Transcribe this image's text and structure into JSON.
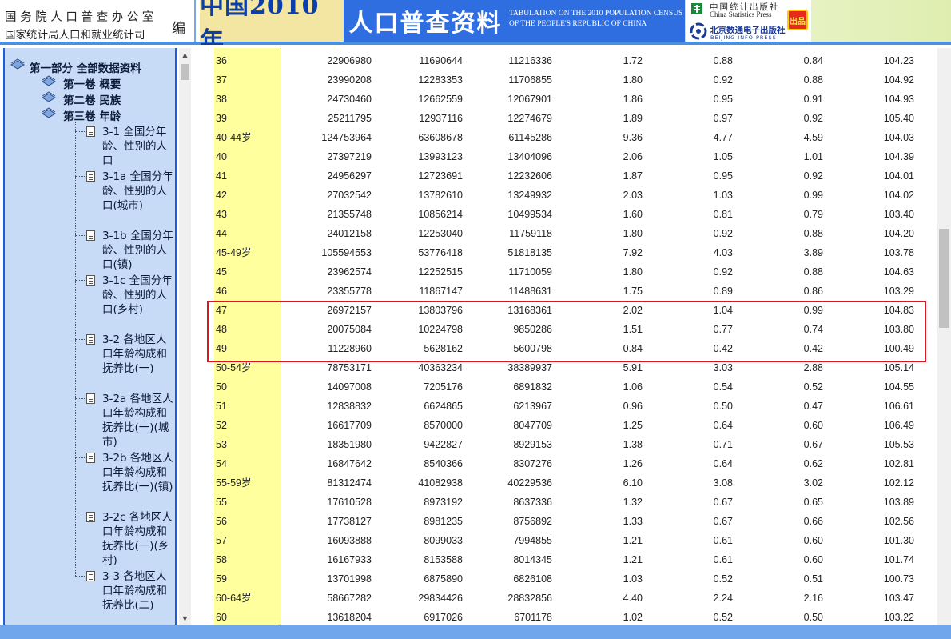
{
  "header": {
    "office": "国务院人口普查办公室",
    "bureau": "国家统计局人口和就业统计司",
    "bian": "编",
    "title_main": "中国2010年",
    "title_sub": "人口普查资料",
    "subtitle_en": "TABULATION ON THE 2010 POPULATION CENSUS OF THE PEOPLE'S REPUBLIC OF CHINA",
    "publisher1_cn": "中国统计出版社",
    "publisher1_en": "China Statistics Press",
    "publisher2_cn": "北京数通电子出版社",
    "publisher2_en": "BEIJING INFO PRESS",
    "badge": "出品"
  },
  "sidebar": {
    "part": "第一部分  全部数据资料",
    "volumes": [
      "第一卷  概要",
      "第二卷  民族",
      "第三卷  年龄"
    ],
    "items": [
      "3-1 全国分年龄、性别的人口",
      "3-1a 全国分年龄、性别的人口(城市)",
      "3-1b 全国分年龄、性别的人口(镇)",
      "3-1c 全国分年龄、性别的人口(乡村)",
      "3-2 各地区人口年龄构成和抚养比(一)",
      "3-2a 各地区人口年龄构成和抚养比(一)(城市)",
      "3-2b 各地区人口年龄构成和抚养比(一)(镇)",
      "3-2c 各地区人口年龄构成和抚养比(一)(乡村)",
      "3-3 各地区人口年龄构成和抚养比(二)"
    ]
  },
  "table": {
    "rows": [
      [
        "36",
        "22906980",
        "11690644",
        "11216336",
        "1.72",
        "0.88",
        "0.84",
        "104.23"
      ],
      [
        "37",
        "23990208",
        "12283353",
        "11706855",
        "1.80",
        "0.92",
        "0.88",
        "104.92"
      ],
      [
        "38",
        "24730460",
        "12662559",
        "12067901",
        "1.86",
        "0.95",
        "0.91",
        "104.93"
      ],
      [
        "39",
        "25211795",
        "12937116",
        "12274679",
        "1.89",
        "0.97",
        "0.92",
        "105.40"
      ],
      [
        "40-44岁",
        "124753964",
        "63608678",
        "61145286",
        "9.36",
        "4.77",
        "4.59",
        "104.03"
      ],
      [
        "40",
        "27397219",
        "13993123",
        "13404096",
        "2.06",
        "1.05",
        "1.01",
        "104.39"
      ],
      [
        "41",
        "24956297",
        "12723691",
        "12232606",
        "1.87",
        "0.95",
        "0.92",
        "104.01"
      ],
      [
        "42",
        "27032542",
        "13782610",
        "13249932",
        "2.03",
        "1.03",
        "0.99",
        "104.02"
      ],
      [
        "43",
        "21355748",
        "10856214",
        "10499534",
        "1.60",
        "0.81",
        "0.79",
        "103.40"
      ],
      [
        "44",
        "24012158",
        "12253040",
        "11759118",
        "1.80",
        "0.92",
        "0.88",
        "104.20"
      ],
      [
        "45-49岁",
        "105594553",
        "53776418",
        "51818135",
        "7.92",
        "4.03",
        "3.89",
        "103.78"
      ],
      [
        "45",
        "23962574",
        "12252515",
        "11710059",
        "1.80",
        "0.92",
        "0.88",
        "104.63"
      ],
      [
        "46",
        "23355778",
        "11867147",
        "11488631",
        "1.75",
        "0.89",
        "0.86",
        "103.29"
      ],
      [
        "47",
        "26972157",
        "13803796",
        "13168361",
        "2.02",
        "1.04",
        "0.99",
        "104.83"
      ],
      [
        "48",
        "20075084",
        "10224798",
        "9850286",
        "1.51",
        "0.77",
        "0.74",
        "103.80"
      ],
      [
        "49",
        "11228960",
        "5628162",
        "5600798",
        "0.84",
        "0.42",
        "0.42",
        "100.49"
      ],
      [
        "50-54岁",
        "78753171",
        "40363234",
        "38389937",
        "5.91",
        "3.03",
        "2.88",
        "105.14"
      ],
      [
        "50",
        "14097008",
        "7205176",
        "6891832",
        "1.06",
        "0.54",
        "0.52",
        "104.55"
      ],
      [
        "51",
        "12838832",
        "6624865",
        "6213967",
        "0.96",
        "0.50",
        "0.47",
        "106.61"
      ],
      [
        "52",
        "16617709",
        "8570000",
        "8047709",
        "1.25",
        "0.64",
        "0.60",
        "106.49"
      ],
      [
        "53",
        "18351980",
        "9422827",
        "8929153",
        "1.38",
        "0.71",
        "0.67",
        "105.53"
      ],
      [
        "54",
        "16847642",
        "8540366",
        "8307276",
        "1.26",
        "0.64",
        "0.62",
        "102.81"
      ],
      [
        "55-59岁",
        "81312474",
        "41082938",
        "40229536",
        "6.10",
        "3.08",
        "3.02",
        "102.12"
      ],
      [
        "55",
        "17610528",
        "8973192",
        "8637336",
        "1.32",
        "0.67",
        "0.65",
        "103.89"
      ],
      [
        "56",
        "17738127",
        "8981235",
        "8756892",
        "1.33",
        "0.67",
        "0.66",
        "102.56"
      ],
      [
        "57",
        "16093888",
        "8099033",
        "7994855",
        "1.21",
        "0.61",
        "0.60",
        "101.30"
      ],
      [
        "58",
        "16167933",
        "8153588",
        "8014345",
        "1.21",
        "0.61",
        "0.60",
        "101.74"
      ],
      [
        "59",
        "13701998",
        "6875890",
        "6826108",
        "1.03",
        "0.52",
        "0.51",
        "100.73"
      ],
      [
        "60-64岁",
        "58667282",
        "29834426",
        "28832856",
        "4.40",
        "2.24",
        "2.16",
        "103.47"
      ],
      [
        "60",
        "13618204",
        "6917026",
        "6701178",
        "1.02",
        "0.52",
        "0.50",
        "103.22"
      ]
    ]
  },
  "colors": {
    "header_blue": "#2f6ee0",
    "title_bg": "#f2e6a2",
    "sidebar_bg": "#c7dbf6",
    "label_col_bg": "#ffff9e",
    "highlight": "#e0141c"
  }
}
